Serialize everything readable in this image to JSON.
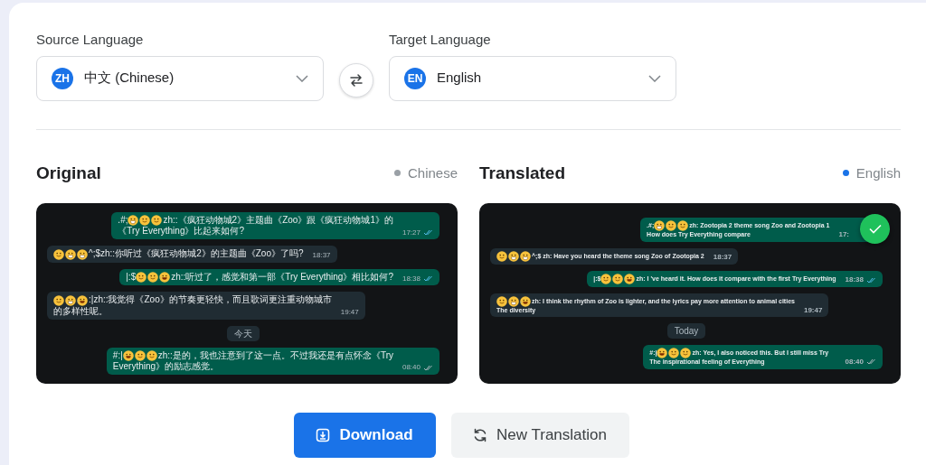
{
  "source": {
    "label": "Source Language",
    "code": "ZH",
    "name": "中文 (Chinese)"
  },
  "target": {
    "label": "Target Language",
    "code": "EN",
    "name": "English"
  },
  "panes": [
    {
      "title": "Original",
      "language": "Chinese",
      "color": "#9aa0a6",
      "messages": [
        {
          "kind": "outgoing",
          "prefix": ".#;",
          "emojis": [
            {
              "kind": "grin"
            },
            {
              "kind": "smile"
            },
            {
              "kind": "smile"
            }
          ],
          "lines": [
            "zh::《疯狂动物城2》主题曲《Zoo》跟《疯狂动物城1》的",
            "《Try Everything》比起来如何?"
          ],
          "time": "17:27",
          "read": true
        },
        {
          "kind": "incoming",
          "emojis": [
            {
              "kind": "smile"
            },
            {
              "kind": "grin"
            },
            {
              "kind": "grin"
            }
          ],
          "lines": [
            "^;$zh::你听过《疯狂动物城2》的主题曲《Zoo》了吗?"
          ],
          "time": "18:37"
        },
        {
          "kind": "outgoing",
          "prefix": "|:$",
          "emojis": [
            {
              "kind": "smile"
            },
            {
              "kind": "smile"
            },
            {
              "kind": "laugh"
            }
          ],
          "lines": [
            "zh::听过了，感觉和第一部《Try Everything》相比如何?"
          ],
          "time": "18:38",
          "read": true
        },
        {
          "kind": "incoming",
          "emojis": [
            {
              "kind": "smile"
            },
            {
              "kind": "grin"
            },
            {
              "kind": "laugh"
            }
          ],
          "lines": [
            ":|zh::我觉得《Zoo》的节奏更轻快，而且歌词更注重动物城市",
            "的多样性呢。"
          ],
          "time": "19:47"
        },
        {
          "kind": "date",
          "text": "今天"
        },
        {
          "kind": "outgoing",
          "prefix": "#:|",
          "emojis": [
            {
              "kind": "laugh"
            },
            {
              "kind": "smile"
            },
            {
              "kind": "smile"
            }
          ],
          "lines": [
            "zh::是的，我也注意到了这一点。不过我还是有点怀念《Try",
            "Everything》的励志感觉。"
          ],
          "time": "08:40",
          "read": false
        }
      ]
    },
    {
      "title": "Translated",
      "language": "English",
      "color": "#1a73e8",
      "verified": true,
      "messages": [
        {
          "kind": "outgoing",
          "prefix": ".#;",
          "emojis": [
            {
              "kind": "grin"
            },
            {
              "kind": "smile"
            },
            {
              "kind": "smile"
            }
          ],
          "lines": [
            "zh: Zootopia 2 theme song Zoo and Zootopia 1",
            "How does Try Everything compare"
          ],
          "time": "17:"
        },
        {
          "kind": "incoming",
          "emojis": [
            {
              "kind": "smile"
            },
            {
              "kind": "grin"
            },
            {
              "kind": "grin"
            }
          ],
          "lines": [
            "^;$ zh: Have you heard the theme song Zoo of Zootopia 2"
          ],
          "time": "18:37"
        },
        {
          "kind": "outgoing",
          "prefix": "|:$",
          "emojis": [
            {
              "kind": "smile"
            },
            {
              "kind": "smile"
            },
            {
              "kind": "laugh"
            }
          ],
          "lines": [
            "zh: I 've heard it. How does it compare with the first Try Everything"
          ],
          "time": "18:38",
          "read": true
        },
        {
          "kind": "incoming",
          "emojis": [
            {
              "kind": "smile"
            },
            {
              "kind": "grin"
            },
            {
              "kind": "laugh"
            }
          ],
          "lines": [
            "zh: I think the rhythm of Zoo is lighter, and the lyrics pay more attention to animal cities",
            "The diversity"
          ],
          "time": "19:47"
        },
        {
          "kind": "date",
          "text": "Today"
        },
        {
          "kind": "outgoing",
          "prefix": "#:|",
          "emojis": [
            {
              "kind": "laugh"
            },
            {
              "kind": "smile"
            },
            {
              "kind": "smile"
            }
          ],
          "lines": [
            "zh: Yes, I also noticed this. But I still miss Try",
            "The inspirational feeling of Everything"
          ],
          "time": "08:40",
          "read": false
        }
      ]
    }
  ],
  "actions": [
    {
      "kind": "download",
      "label": "Download"
    },
    {
      "kind": "reset",
      "label": "New Translation"
    }
  ]
}
